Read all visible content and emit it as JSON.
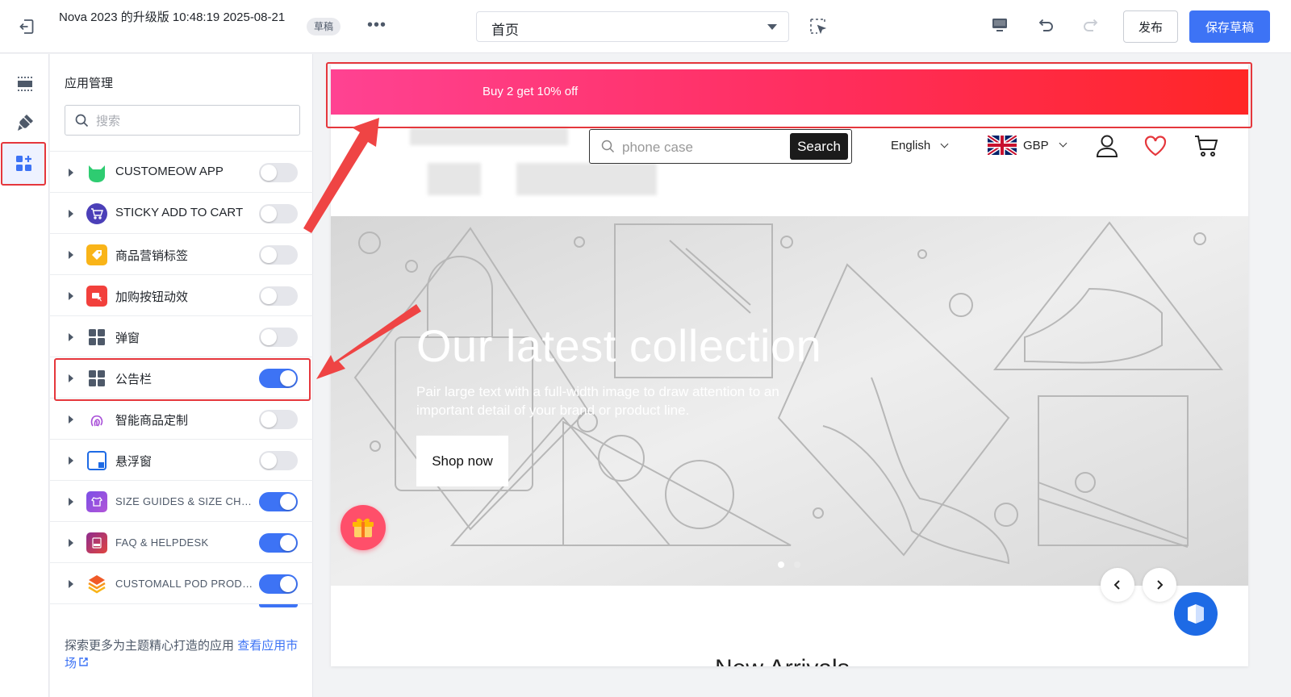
{
  "topbar": {
    "theme_title": "Nova 2023 的升级版 10:48:19 2025-08-21",
    "draft_badge": "草稿",
    "more_label": "•••",
    "page_select_value": "首页",
    "publish_label": "发布",
    "save_draft_label": "保存草稿"
  },
  "rail": {
    "items": [
      "sections-icon",
      "theme-brush-icon",
      "apps-icon"
    ],
    "active": "apps-icon"
  },
  "panel": {
    "title": "应用管理",
    "search_placeholder": "搜索",
    "apps": [
      {
        "name": "CUSTOMEOW APP",
        "enabled": false,
        "icon": "customeow-cat-icon"
      },
      {
        "name": "STICKY ADD TO CART",
        "enabled": false,
        "icon": "sticky-cart-icon"
      },
      {
        "name": "商品营销标签",
        "enabled": false,
        "icon": "tag-icon"
      },
      {
        "name": "加购按钮动效",
        "enabled": false,
        "icon": "cart-effect-icon"
      },
      {
        "name": "弹窗",
        "enabled": false,
        "icon": "grid-icon"
      },
      {
        "name": "公告栏",
        "enabled": true,
        "icon": "grid-icon"
      },
      {
        "name": "智能商品定制",
        "enabled": false,
        "icon": "fingerprint-icon"
      },
      {
        "name": "悬浮窗",
        "enabled": false,
        "icon": "float-window-icon"
      },
      {
        "name": "SIZE GUIDES & SIZE CHART",
        "enabled": true,
        "icon": "size-guide-icon"
      },
      {
        "name": "FAQ & HELPDESK",
        "enabled": true,
        "icon": "faq-icon"
      },
      {
        "name": "CUSTOMALL POD PRODUCT",
        "enabled": true,
        "icon": "customall-icon"
      }
    ],
    "footer_text": "探索更多为主题精心打造的应用",
    "footer_link": "查看应用市场"
  },
  "preview": {
    "announcement": "Buy 2 get 10% off",
    "search_placeholder": "phone case",
    "search_button": "Search",
    "language": "English",
    "currency": "GBP",
    "hero_heading": "Our latest collection",
    "hero_subtext": "Pair large text with a full-width image to draw attention to an important detail of your brand or product line.",
    "hero_button": "Shop now",
    "next_section_heading": "New Arrivals",
    "slides": 2,
    "active_slide": 1
  },
  "colors": {
    "accent": "#3d73f5",
    "highlight": "#e5373c",
    "announce_start": "#ff4292",
    "announce_end": "#ff2626"
  }
}
